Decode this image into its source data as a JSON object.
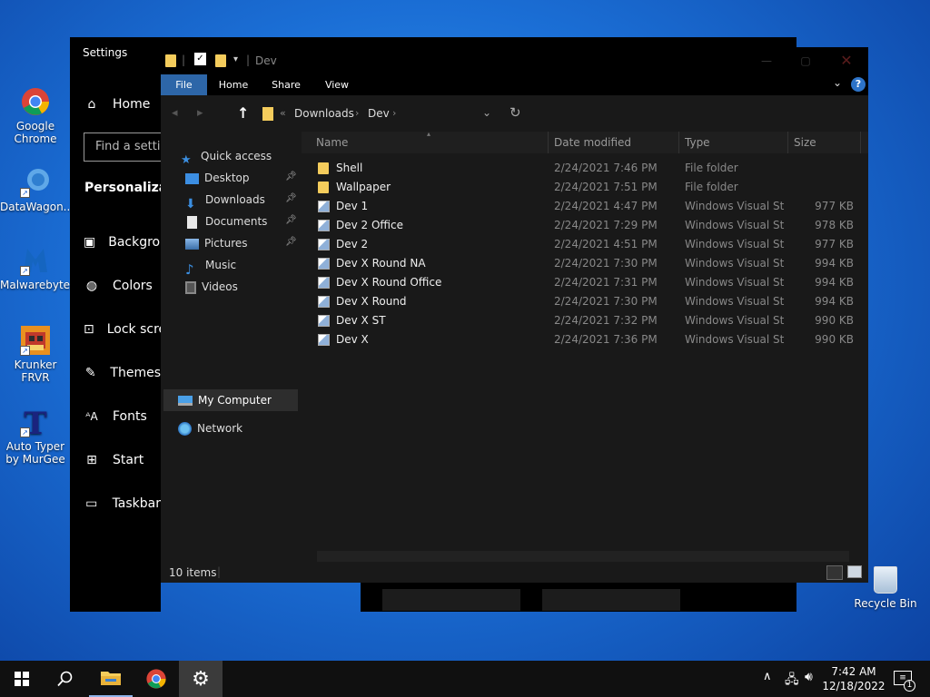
{
  "desktop": {
    "icons": [
      {
        "label": "Google Chrome",
        "icon": "chrome-icon"
      },
      {
        "label": "DataWagon...",
        "icon": "datawagon-icon"
      },
      {
        "label": "Malwarebytes",
        "icon": "malwarebytes-icon"
      },
      {
        "label": "Krunker FRVR",
        "icon": "krunker-icon"
      },
      {
        "label": "Auto Typer by MurGee",
        "icon": "autotyper-icon"
      }
    ],
    "recycle_bin": "Recycle Bin"
  },
  "settings": {
    "title": "Settings",
    "home": "Home",
    "search_placeholder": "Find a setting",
    "section": "Personalization",
    "items": [
      "Background",
      "Colors",
      "Lock screen",
      "Themes",
      "Fonts",
      "Start",
      "Taskbar"
    ]
  },
  "explorer": {
    "title": "Dev",
    "tabs": [
      "File",
      "Home",
      "Share",
      "View"
    ],
    "help": "?",
    "breadcrumb": [
      "Downloads",
      "Dev"
    ],
    "nav": {
      "quick_access": "Quick access",
      "pinned": [
        "Desktop",
        "Downloads",
        "Documents",
        "Pictures"
      ],
      "other": [
        "Music",
        "Videos"
      ],
      "my_computer": "My Computer",
      "network": "Network"
    },
    "columns": [
      "Name",
      "Date modified",
      "Type",
      "Size"
    ],
    "files": [
      {
        "name": "Shell",
        "date": "2/24/2021 7:46 PM",
        "type": "File folder",
        "size": "",
        "kind": "folder"
      },
      {
        "name": "Wallpaper",
        "date": "2/24/2021 7:51 PM",
        "type": "File folder",
        "size": "",
        "kind": "folder"
      },
      {
        "name": "Dev 1",
        "date": "2/24/2021 4:47 PM",
        "type": "Windows Visual St...",
        "size": "977 KB",
        "kind": "sln"
      },
      {
        "name": "Dev 2 Office",
        "date": "2/24/2021 7:29 PM",
        "type": "Windows Visual St...",
        "size": "978 KB",
        "kind": "sln"
      },
      {
        "name": "Dev 2",
        "date": "2/24/2021 4:51 PM",
        "type": "Windows Visual St...",
        "size": "977 KB",
        "kind": "sln"
      },
      {
        "name": "Dev X Round NA",
        "date": "2/24/2021 7:30 PM",
        "type": "Windows Visual St...",
        "size": "994 KB",
        "kind": "sln"
      },
      {
        "name": "Dev X Round Office",
        "date": "2/24/2021 7:31 PM",
        "type": "Windows Visual St...",
        "size": "994 KB",
        "kind": "sln"
      },
      {
        "name": "Dev X Round",
        "date": "2/24/2021 7:30 PM",
        "type": "Windows Visual St...",
        "size": "994 KB",
        "kind": "sln"
      },
      {
        "name": "Dev X ST",
        "date": "2/24/2021 7:32 PM",
        "type": "Windows Visual St...",
        "size": "990 KB",
        "kind": "sln"
      },
      {
        "name": "Dev X",
        "date": "2/24/2021 7:36 PM",
        "type": "Windows Visual St...",
        "size": "990 KB",
        "kind": "sln"
      }
    ],
    "status": "10 items"
  },
  "taskbar": {
    "time": "7:42 AM",
    "date": "12/18/2022",
    "notification_count": "1"
  },
  "colors": {
    "accent": "#2d66a8",
    "folder": "#f4cc5c",
    "window_bg": "#191919"
  }
}
